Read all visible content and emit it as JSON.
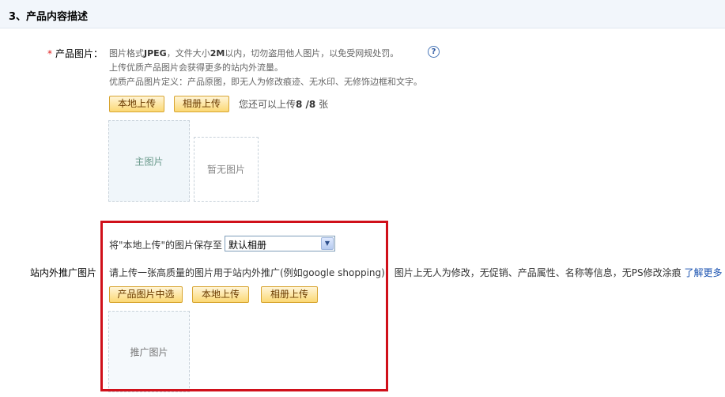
{
  "section": {
    "title": "3、产品内容描述"
  },
  "product_images": {
    "label": "产品图片：",
    "required_mark": "*",
    "hint_line1_a": "图片格式",
    "hint_line1_fmt": "JPEG",
    "hint_line1_b": "，文件大小",
    "hint_line1_size": "2M",
    "hint_line1_c": "以内，切勿盗用他人图片，以免受网规处罚。",
    "help_icon": "?",
    "hint_line2": "上传优质产品图片会获得更多的站内外流量。",
    "hint_line3": "优质产品图片定义：产品原图，即无人为修改痕迹、无水印、无修饰边框和文字。",
    "local_upload_label": "本地上传",
    "album_upload_label": "相册上传",
    "remaining_prefix": "您还可以上传",
    "remaining_count": "8 /8",
    "remaining_suffix": " 张",
    "main_slot_label": "主图片",
    "empty_slot_label": "暂无图片"
  },
  "promo_images": {
    "save_label": "将\"本地上传\"的图片保存至",
    "album_selected": "默认相册",
    "label": "站内外推广图片",
    "description": "请上传一张高质量的图片用于站内外推广(例如google shopping)，图片上无人为修改，无促销、产品属性、名称等信息，无PS修改涂痕",
    "learn_more": "了解更多",
    "choose_product_label": "产品图片中选",
    "local_upload_label": "本地上传",
    "album_upload_label": "相册上传",
    "slot_label": "推广图片"
  },
  "colors": {
    "highlight": "#d0101a",
    "link": "#1a52b0",
    "button_border": "#d8a531"
  }
}
